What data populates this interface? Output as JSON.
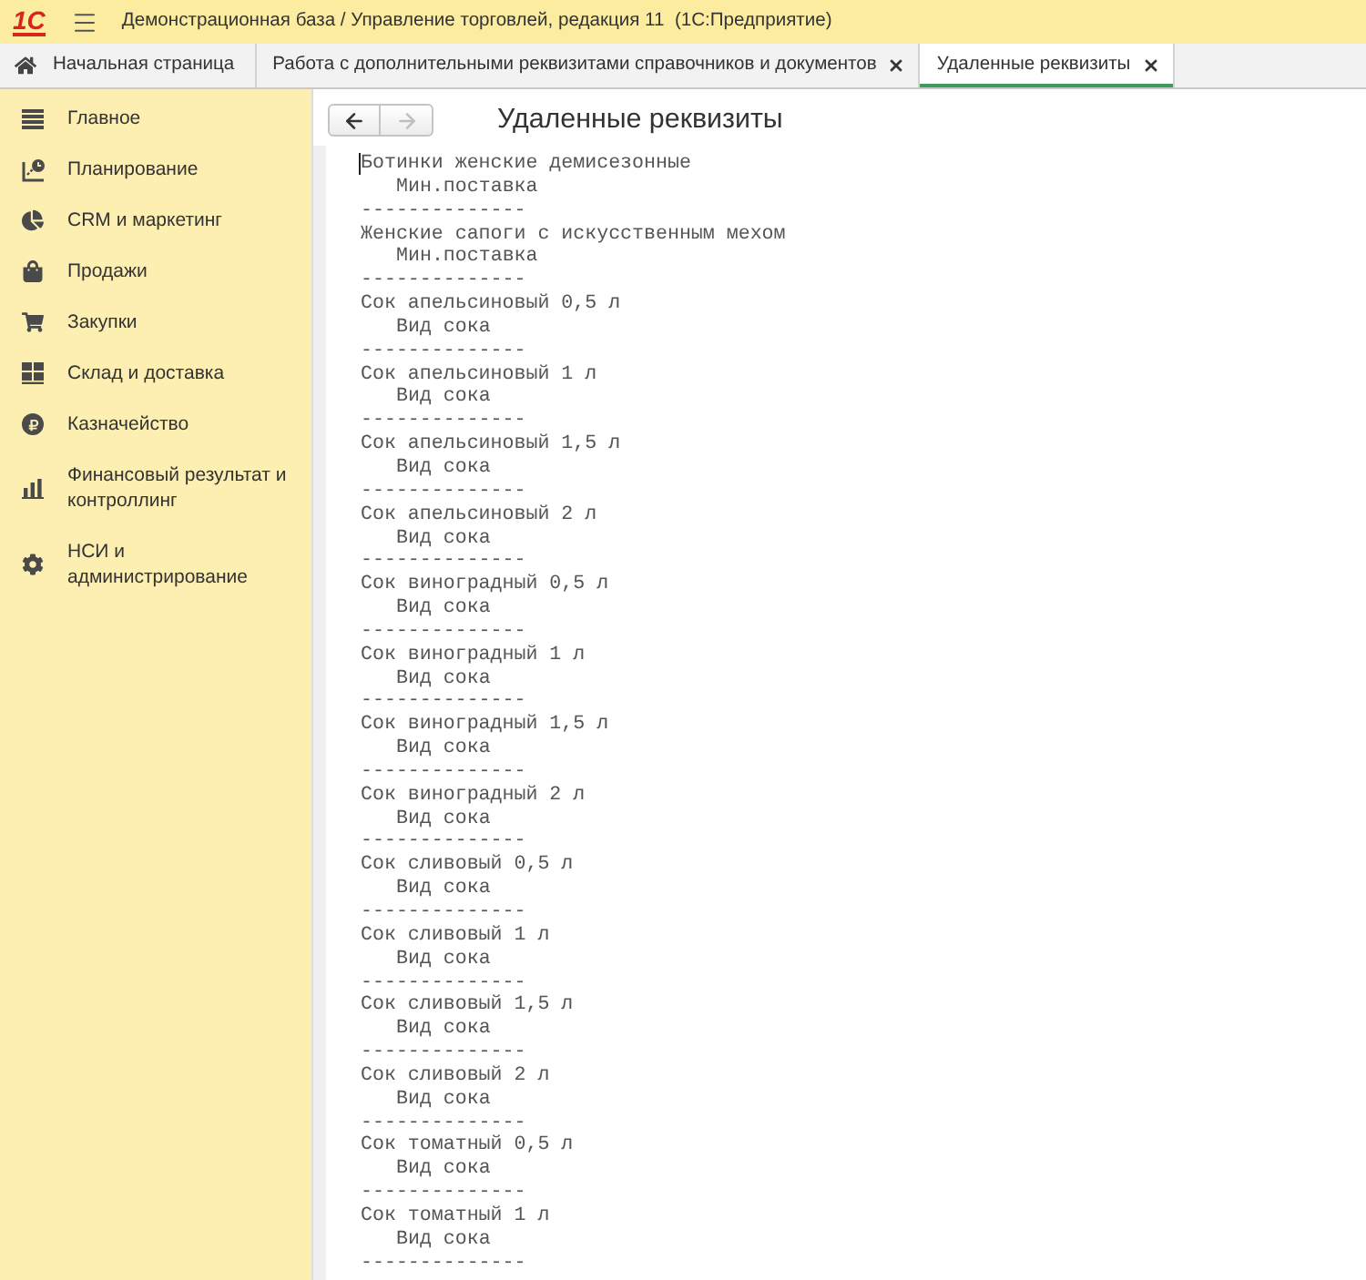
{
  "window": {
    "logo": "1С",
    "title": "Демонстрационная база / Управление торговлей, редакция 11  (1С:Предприятие)"
  },
  "tabs": [
    {
      "kind": "home",
      "label": "Начальная страница",
      "selected": false
    },
    {
      "kind": "form",
      "label": "Работа с дополнительными реквизитами справочников и документов",
      "selected": false
    },
    {
      "kind": "form",
      "label": "Удаленные реквизиты",
      "selected": true
    }
  ],
  "sidebar": {
    "items": [
      {
        "label": "Главное"
      },
      {
        "label": "Планирование"
      },
      {
        "label": "CRM и маркетинг"
      },
      {
        "label": "Продажи"
      },
      {
        "label": "Закупки"
      },
      {
        "label": "Склад и доставка"
      },
      {
        "label": "Казначейство"
      },
      {
        "label": "Финансовый результат и контроллинг"
      },
      {
        "label": "НСИ и администрирование"
      }
    ]
  },
  "navigation": [
    {
      "kind": "back",
      "disabled": false
    },
    {
      "kind": "forward",
      "disabled": true
    }
  ],
  "form": {
    "title": "Удаленные реквизиты",
    "entries": [
      {
        "name": "Ботинки женские демисезонные",
        "attribute": "Мин.поставка",
        "separator": "--------------"
      },
      {
        "name": "Женские сапоги с искусственным мехом",
        "attribute": "Мин.поставка",
        "separator": "--------------"
      },
      {
        "name": "Сок апельсиновый 0,5 л",
        "attribute": "Вид сока",
        "separator": "--------------"
      },
      {
        "name": "Сок апельсиновый 1 л",
        "attribute": "Вид сока",
        "separator": "--------------"
      },
      {
        "name": "Сок апельсиновый 1,5 л",
        "attribute": "Вид сока",
        "separator": "--------------"
      },
      {
        "name": "Сок апельсиновый 2 л",
        "attribute": "Вид сока",
        "separator": "--------------"
      },
      {
        "name": "Сок виноградный 0,5 л",
        "attribute": "Вид сока",
        "separator": "--------------"
      },
      {
        "name": "Сок виноградный 1 л",
        "attribute": "Вид сока",
        "separator": "--------------"
      },
      {
        "name": "Сок виноградный 1,5 л",
        "attribute": "Вид сока",
        "separator": "--------------"
      },
      {
        "name": "Сок виноградный 2 л",
        "attribute": "Вид сока",
        "separator": "--------------"
      },
      {
        "name": "Сок сливовый 0,5 л",
        "attribute": "Вид сока",
        "separator": "--------------"
      },
      {
        "name": "Сок сливовый 1 л",
        "attribute": "Вид сока",
        "separator": "--------------"
      },
      {
        "name": "Сок сливовый 1,5 л",
        "attribute": "Вид сока",
        "separator": "--------------"
      },
      {
        "name": "Сок сливовый 2 л",
        "attribute": "Вид сока",
        "separator": "--------------"
      },
      {
        "name": "Сок томатный 0,5 л",
        "attribute": "Вид сока",
        "separator": "--------------"
      },
      {
        "name": "Сок томатный 1 л",
        "attribute": "Вид сока",
        "separator": "--------------"
      }
    ]
  }
}
